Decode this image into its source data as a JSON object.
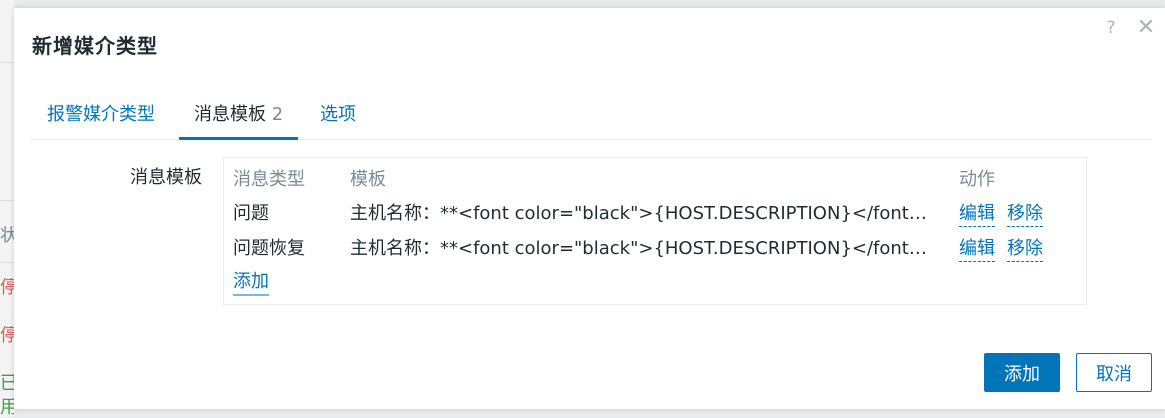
{
  "background": {
    "fragments": [
      {
        "text": "状",
        "color": "#768d99"
      },
      {
        "text": "停",
        "color": "#e45959"
      },
      {
        "text": "停",
        "color": "#e45959"
      },
      {
        "text": "已",
        "color": "#429e47"
      },
      {
        "text": "用",
        "color": "#429e47"
      }
    ]
  },
  "dialog": {
    "title": "新增媒介类型",
    "help_glyph": "?",
    "close_glyph": "✕"
  },
  "tabs": [
    {
      "label": "报警媒介类型",
      "count": "",
      "active": false
    },
    {
      "label": "消息模板",
      "count": "2",
      "active": true
    },
    {
      "label": "选项",
      "count": "",
      "active": false
    }
  ],
  "form": {
    "label": "消息模板",
    "table": {
      "headers": {
        "type": "消息类型",
        "template": "模板",
        "actions": "动作"
      },
      "rows": [
        {
          "type": "问题",
          "template": "主机名称：**<font color=\"black\">{HOST.DESCRIPTION}</font>** ...",
          "edit": "编辑",
          "remove": "移除"
        },
        {
          "type": "问题恢复",
          "template": "主机名称：**<font color=\"black\">{HOST.DESCRIPTION}</font>** ...",
          "edit": "编辑",
          "remove": "移除"
        }
      ],
      "add_label": "添加"
    }
  },
  "footer": {
    "add_button": "添加",
    "cancel_button": "取消"
  },
  "colors": {
    "accent": "#0275b8",
    "muted": "#768d99",
    "text": "#1f2c33"
  }
}
